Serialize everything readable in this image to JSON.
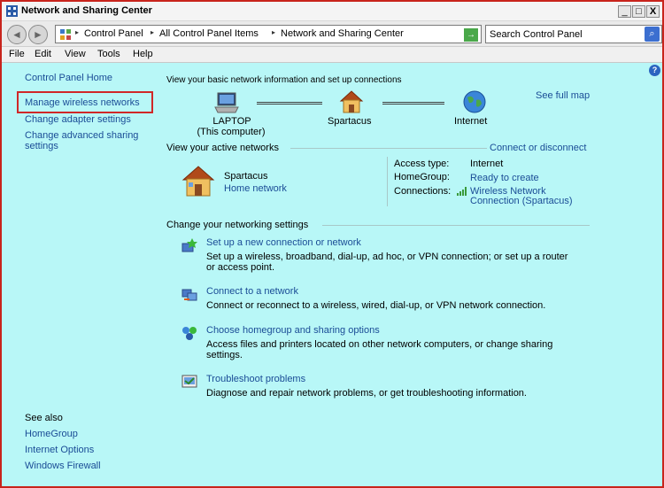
{
  "window": {
    "title": "Network and Sharing Center",
    "controls": {
      "minimize": "_",
      "maximize": "□",
      "close": "X"
    }
  },
  "address": {
    "back_icon": "back-arrow-icon",
    "forward_icon": "forward-arrow-icon",
    "crumbs": [
      "Control Panel",
      "All Control Panel Items",
      "Network and Sharing Center"
    ],
    "go_symbol": "→",
    "search_placeholder": "Search Control Panel",
    "search_symbol": "⌕"
  },
  "menu": [
    "File",
    "Edit",
    "View",
    "Tools",
    "Help"
  ],
  "help_symbol": "?",
  "sidebar": {
    "home": "Control Panel Home",
    "items": [
      "Manage wireless networks",
      "Change adapter settings",
      "Change advanced sharing settings"
    ],
    "see_also_title": "See also",
    "see_also": [
      "HomeGroup",
      "Internet Options",
      "Windows Firewall"
    ]
  },
  "main": {
    "heading": "View your basic network information and set up connections",
    "see_full_map": "See full map",
    "map": {
      "computer_line1": "LAPTOP",
      "computer_line2": "(This computer)",
      "network": "Spartacus",
      "internet": "Internet"
    },
    "active_heading": "View your active networks",
    "connect_disconnect": "Connect or disconnect",
    "active": {
      "name": "Spartacus",
      "type": "Home network",
      "access_type_label": "Access type:",
      "access_type_value": "Internet",
      "homegroup_label": "HomeGroup:",
      "homegroup_value": "Ready to create",
      "connections_label": "Connections:",
      "connections_line1": "Wireless Network",
      "connections_line2": "Connection (Spartacus)"
    },
    "change_heading": "Change your networking settings",
    "tasks": [
      {
        "title": "Set up a new connection or network",
        "desc1": "Set up a wireless, broadband, dial-up, ad hoc, or VPN connection; or set up a router",
        "desc2": "or access point."
      },
      {
        "title": "Connect to a network",
        "desc1": "Connect or reconnect to a wireless, wired, dial-up, or VPN network connection.",
        "desc2": ""
      },
      {
        "title": "Choose homegroup and sharing options",
        "desc1": "Access files and printers located on other network computers, or change sharing",
        "desc2": "settings."
      },
      {
        "title": "Troubleshoot problems",
        "desc1": "Diagnose and repair network problems, or get troubleshooting information.",
        "desc2": ""
      }
    ]
  },
  "colors": {
    "link": "#1a4c96",
    "content_bg": "#b8f7f7",
    "highlight": "#d02828"
  }
}
